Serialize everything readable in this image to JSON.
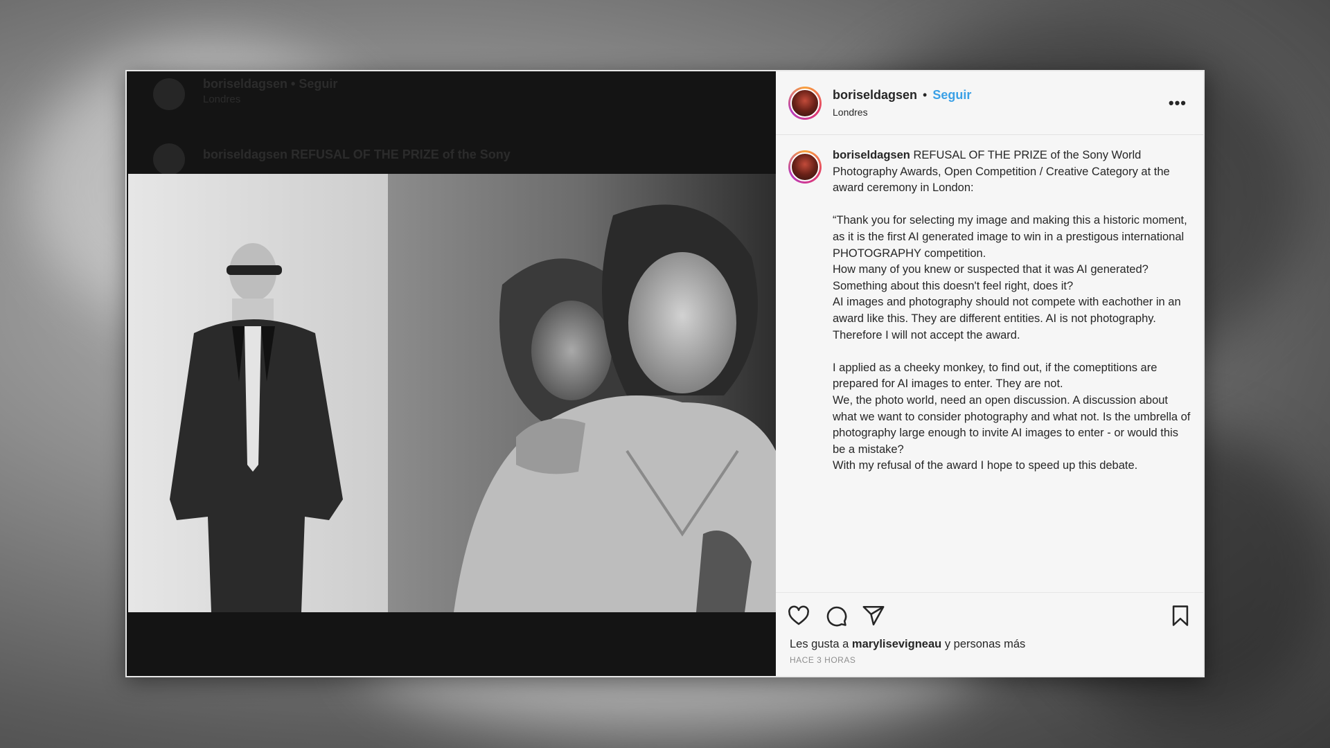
{
  "post": {
    "username": "boriseldagsen",
    "separator": "•",
    "follow_label": "Seguir",
    "location": "Londres",
    "more_label": "•••",
    "caption_user": "boriseldagsen",
    "caption_text": " REFUSAL OF THE PRIZE of the Sony World Photography Awards, Open Competition / Creative Category at the award ceremony in London:\n\n“Thank you for selecting my image and making this a historic moment, as it is the first AI generated image to win in a prestigous international PHOTOGRAPHY competition.\nHow many of you knew or suspected that it was AI generated? Something about this doesn't feel right, does it?\nAI images and photography should not compete with eachother in an award like this. They are different entities. AI is not photography. Therefore I will not accept the award.\n\nI applied as a cheeky monkey, to find out, if the comeptitions are prepared for AI images to enter. They are not.\nWe, the photo world, need an open discussion. A discussion about what we want to consider photography and what not. Is the umbrella of photography large enough to invite AI images to enter - or would this be a mistake?\nWith my refusal of the award I hope to speed up this debate.",
    "likes_prefix": "Les gusta a ",
    "likes_user": "marylisevigneau",
    "likes_suffix": " y personas más",
    "time": "HACE 3 HORAS"
  },
  "ghost": {
    "username": "boriseldagsen • Seguir",
    "location": "Londres",
    "caption_start": "boriseldagsen REFUSAL OF THE PRIZE of the Sony"
  },
  "icons": [
    "heart-icon",
    "comment-icon",
    "share-icon",
    "bookmark-icon"
  ],
  "colors": {
    "follow": "#3aa0e6",
    "panel_bg": "#f6f6f6",
    "text": "#262626"
  }
}
